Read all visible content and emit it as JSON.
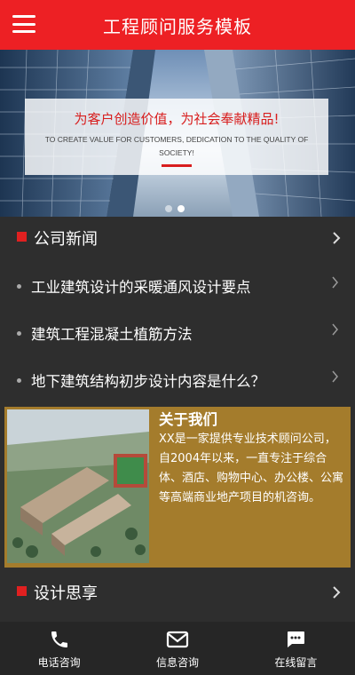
{
  "header": {
    "title": "工程顾问服务模板"
  },
  "banner": {
    "slogan_cn": "为客户创造价值，为社会奉献精品!",
    "slogan_en": "TO CREATE VALUE FOR CUSTOMERS, DEDICATION TO THE QUALITY OF SOCIETY!",
    "slide_count": 2,
    "active_slide": 2
  },
  "news": {
    "title": "公司新闻",
    "items": [
      {
        "title": "工业建筑设计的采暖通风设计要点"
      },
      {
        "title": "建筑工程混凝土植筋方法"
      },
      {
        "title": "地下建筑结构初步设计内容是什么？"
      }
    ]
  },
  "about": {
    "title": "关于我们",
    "text": "XX是一家提供专业技术顾问公司，自2004年以来，一直专注于综合体、酒店、购物中心、办公楼、公寓等高端商业地产项目的机咨询。"
  },
  "design": {
    "title": "设计思享"
  },
  "footer": {
    "items": [
      {
        "label": "电话咨询",
        "icon": "phone-icon"
      },
      {
        "label": "信息咨询",
        "icon": "mail-icon"
      },
      {
        "label": "在线留言",
        "icon": "chat-icon"
      }
    ]
  },
  "colors": {
    "brand_red": "#ed2024",
    "about_gold": "#a47c2c",
    "background": "#2e2e2e"
  }
}
